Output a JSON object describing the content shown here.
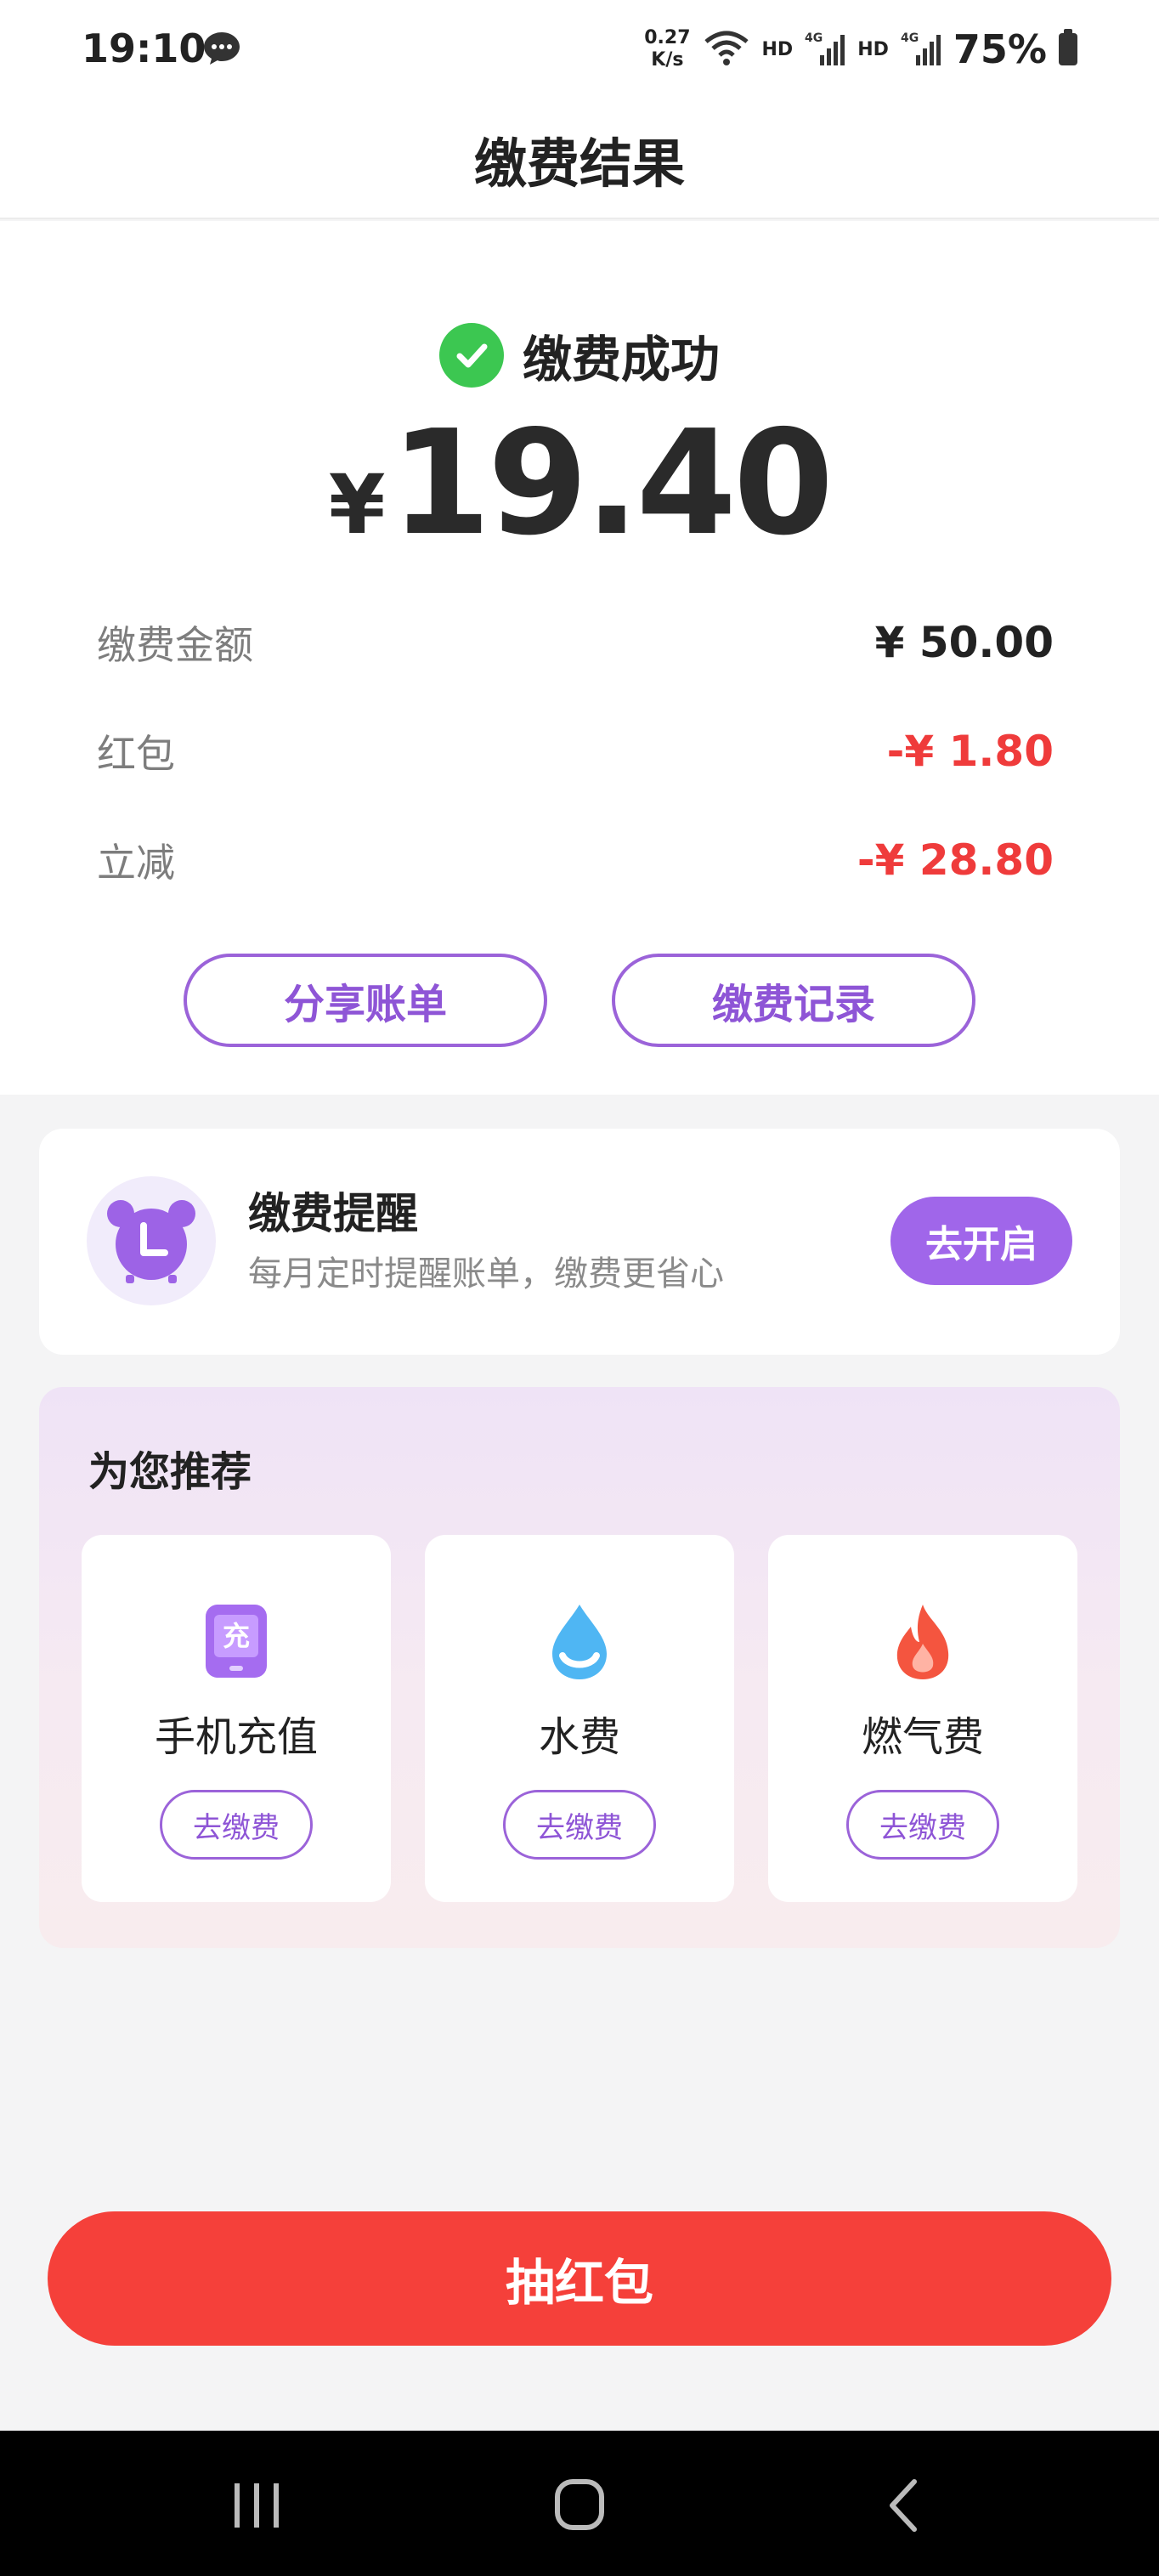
{
  "status_bar": {
    "time": "19:10",
    "net_speed_value": "0.27",
    "net_speed_unit": "K/s",
    "hd1": "HD",
    "hd2": "HD",
    "net_type": "4G",
    "battery": "75%"
  },
  "header": {
    "title": "缴费结果"
  },
  "result": {
    "status": "缴费成功",
    "currency": "¥",
    "amount": "19.40",
    "details": [
      {
        "label": "缴费金额",
        "value": "¥ 50.00"
      },
      {
        "label": "红包",
        "value": "-¥ 1.80"
      },
      {
        "label": "立减",
        "value": "-¥ 28.80"
      }
    ],
    "share_button": "分享账单",
    "records_button": "缴费记录"
  },
  "reminder": {
    "title": "缴费提醒",
    "description": "每月定时提醒账单，缴费更省心",
    "button": "去开启"
  },
  "recommend": {
    "title": "为您推荐",
    "items": [
      {
        "label": "手机充值",
        "button": "去缴费",
        "icon": "phone-recharge-icon",
        "icon_text": "充"
      },
      {
        "label": "水费",
        "button": "去缴费",
        "icon": "water-drop-icon"
      },
      {
        "label": "燃气费",
        "button": "去缴费",
        "icon": "gas-flame-icon"
      }
    ]
  },
  "lottery_button": "抽红包",
  "colors": {
    "accent_purple": "#9b63d9",
    "success_green": "#3cc751",
    "discount_red": "#ef3b3b",
    "primary_red": "#f5403a"
  }
}
